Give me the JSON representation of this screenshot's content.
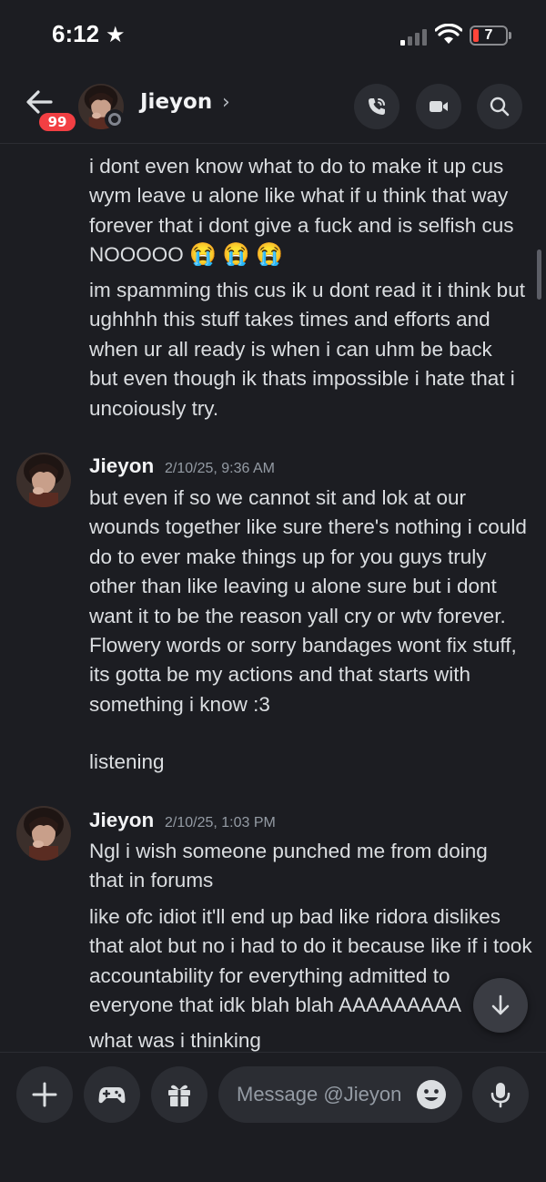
{
  "status_bar": {
    "time": "6:12",
    "focus_icon": "star-icon",
    "battery_level": "7"
  },
  "header": {
    "unread_count": "99",
    "contact_name": "Jieyon",
    "chevron": "›",
    "buttons": [
      "call-icon",
      "video-icon",
      "search-icon"
    ]
  },
  "messages": {
    "m1": "i dont even know what to do to make it up cus wym leave u alone like what if u think that way forever that i dont give a fuck and is selfish cus NOOOOO",
    "m1_emojis": "😭 😭 😭",
    "m2": "im spamming this cus ik u dont read it i think but ughhhh this stuff takes times and efforts and when ur all ready is when i can uhm be back but even though ik thats impossible i hate that i uncoiously try.",
    "g2": {
      "author": "Jieyon",
      "timestamp": "2/10/25, 9:36 AM"
    },
    "m3": "but even if so we cannot sit and lok at our wounds together like sure there's nothing i could do to ever make things up for you guys truly other than like leaving u alone sure but i dont want it to be the reason yall cry or wtv forever. Flowery words or sorry bandages wont fix stuff, its gotta be my actions and that starts with something i know :3",
    "m4": "listening",
    "g3": {
      "author": "Jieyon",
      "timestamp": "2/10/25, 1:03 PM"
    },
    "m5": "Ngl i wish someone punched me from doing that in forums",
    "m6": "like ofc idiot it'll end up bad like ridora dislikes that alot but no i had to do it because like if i took accountability for everything admitted to everyone that idk blah blah AAAAAAAAA",
    "m7": "what was i thinking"
  },
  "composer": {
    "placeholder": "Message @Jieyon"
  },
  "colors": {
    "background": "#1c1d22",
    "badge": "#f23f43",
    "button_bg": "#2b2d33",
    "text": "#dbdee1",
    "muted": "#949ba4"
  }
}
